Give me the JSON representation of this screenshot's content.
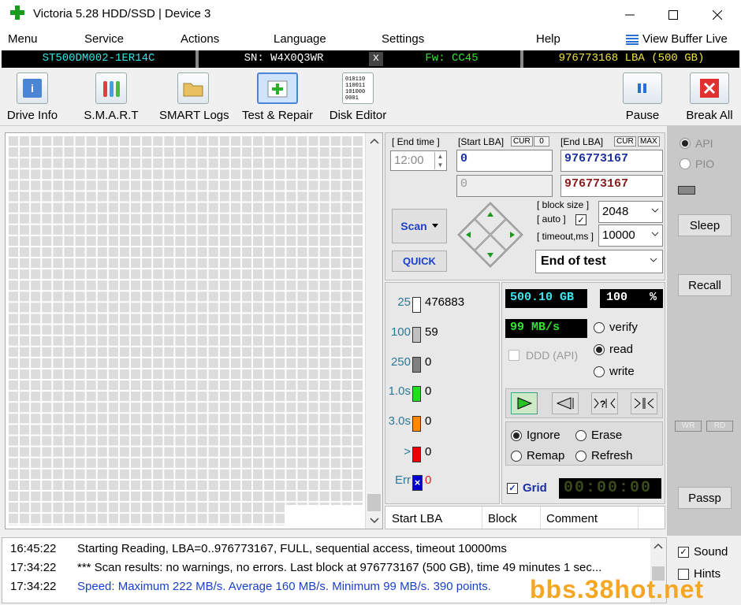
{
  "window": {
    "title": "Victoria 5.28 HDD/SSD | Device 3"
  },
  "menu": [
    "Menu",
    "Service",
    "Actions",
    "Language",
    "Settings",
    "Help"
  ],
  "menu_right": "View Buffer Live",
  "device": {
    "model": "ST500DM002-1ER14C",
    "serial": "SN: W4X0Q3WR",
    "close_mark": "x",
    "firmware": "Fw: CC45",
    "capacity": "976773168 LBA (500 GB)"
  },
  "toolbar": {
    "drive_info": "Drive Info",
    "smart": "S.M.A.R.T",
    "smart_logs": "SMART Logs",
    "test_repair": "Test & Repair",
    "disk_editor": "Disk Editor",
    "pause": "Pause",
    "break_all": "Break All"
  },
  "controls": {
    "end_time_label": "[ End time ]",
    "end_time_value": "12:00",
    "start_lba_label": "[Start LBA]",
    "cur_tag": "CUR",
    "zero_tag": "0",
    "end_lba_label": "[End LBA]",
    "max_tag": "MAX",
    "start_lba": "0",
    "start_lba_2": "0",
    "end_lba": "976773167",
    "end_lba_2": "976773167",
    "scan_label": "Scan",
    "quick_label": "QUICK",
    "block_size_label": "[ block size ]",
    "auto_label": "[ auto ]",
    "block_size": "2048",
    "timeout_label": "[ timeout,ms ]",
    "timeout": "10000",
    "end_of_test": "End of test"
  },
  "stats": [
    {
      "label": "25",
      "value": "476883",
      "color": "#ffffff"
    },
    {
      "label": "100",
      "value": "59",
      "color": "#c0c0c0"
    },
    {
      "label": "250",
      "value": "0",
      "color": "#808080"
    },
    {
      "label": "1.0s",
      "value": "0",
      "color": "#22dd22"
    },
    {
      "label": "3.0s",
      "value": "0",
      "color": "#ff8800"
    },
    {
      "label": ">",
      "value": "0",
      "color": "#ee0000"
    },
    {
      "label": "Err",
      "value": "0",
      "color": "#0000cc"
    }
  ],
  "status": {
    "size": "500.10 GB",
    "percent": "100",
    "percent_sign": "%",
    "speed": "99 MB/s",
    "verify": "verify",
    "read": "read",
    "write": "write",
    "ddd": "DDD (API)",
    "ignore": "Ignore",
    "erase": "Erase",
    "remap": "Remap",
    "refresh": "Refresh",
    "grid": "Grid",
    "timer": "00:00:00"
  },
  "side": {
    "api": "API",
    "pio": "PIO",
    "sleep": "Sleep",
    "recall": "Recall",
    "wr": "WR",
    "rd": "RD",
    "passp": "Passp",
    "sound": "Sound",
    "hints": "Hints"
  },
  "table": {
    "col1": "Start LBA",
    "col2": "Block",
    "col3": "Comment"
  },
  "log": [
    {
      "time": "16:45:22",
      "text": "Starting Reading, LBA=0..976773167, FULL, sequential access, timeout 10000ms",
      "color": "#000000"
    },
    {
      "time": "17:34:22",
      "text": "*** Scan results: no warnings, no errors. Last block at 976773167 (500 GB), time 49 minutes 1 sec...",
      "color": "#000000"
    },
    {
      "time": "17:34:22",
      "text": "Speed: Maximum 222 MB/s. Average 160 MB/s. Minimum 99 MB/s. 390 points.",
      "color": "#1a3fcc"
    }
  ],
  "watermark": "bbs.38hot.net"
}
